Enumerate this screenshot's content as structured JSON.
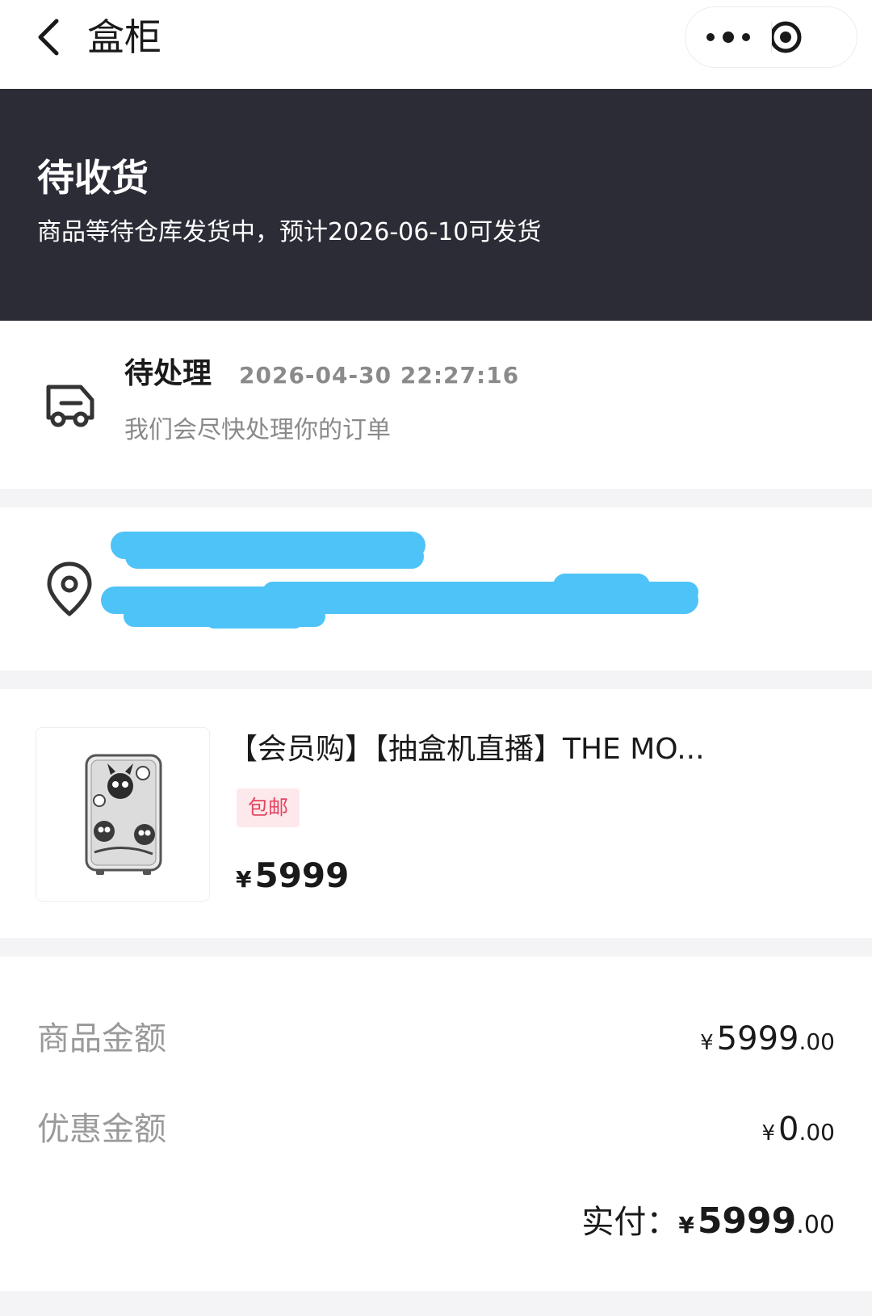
{
  "nav": {
    "title": "盒柜",
    "back_icon": "chevron-left-icon",
    "more_icon": "more-dots-icon",
    "close_icon": "target-circle-icon"
  },
  "status": {
    "title": "待收货",
    "subtitle": "商品等待仓库发货中，预计2026-06-10可发货"
  },
  "processing": {
    "icon": "truck-icon",
    "status": "待处理",
    "time": "2026-04-30 22:27:16",
    "note": "我们会尽快处理你的订单"
  },
  "address": {
    "icon": "location-pin-icon",
    "redaction_color": "#4ec3f7"
  },
  "product": {
    "title": "【会员购】【抽盒机直播】THE MO...",
    "tag": "包邮",
    "currency": "¥",
    "price": "5999"
  },
  "summary": {
    "goods_label": "商品金额",
    "goods_currency": "¥",
    "goods_int": "5999",
    "goods_dec": ".00",
    "discount_label": "优惠金额",
    "discount_currency": "¥",
    "discount_int": "0",
    "discount_dec": ".00",
    "paid_label": "实付：",
    "paid_currency": "¥",
    "paid_int": "5999",
    "paid_dec": ".00"
  },
  "colors": {
    "banner": "#2c2c37",
    "tag_text": "#e4455f",
    "tag_bg": "#fde8ec"
  }
}
